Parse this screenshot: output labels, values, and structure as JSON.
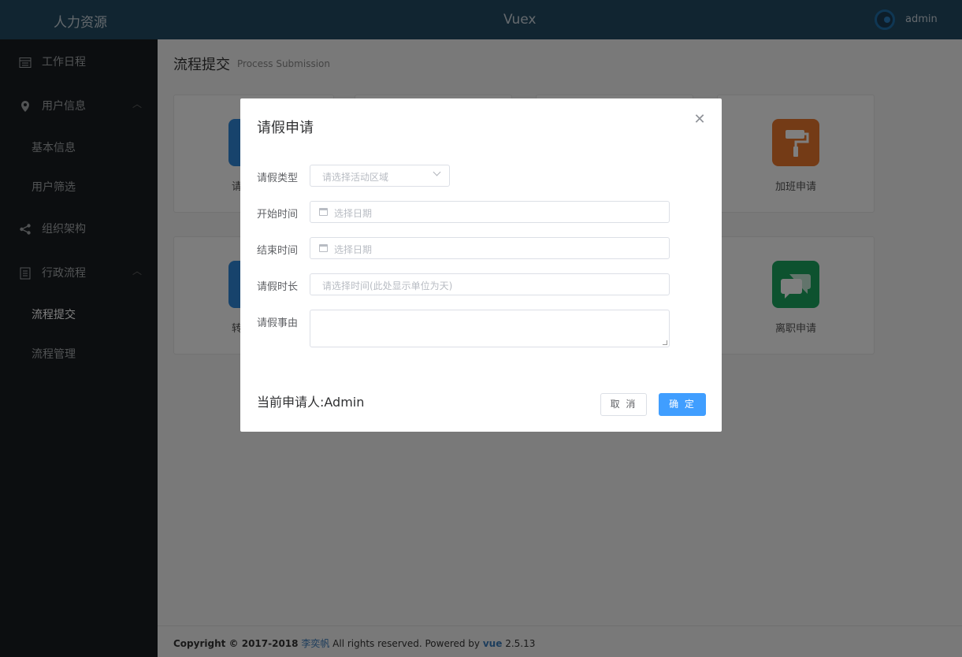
{
  "header": {
    "brand": "人力资源",
    "center_title": "Vuex",
    "user": "admin"
  },
  "sidebar": {
    "items": [
      {
        "label": "工作日程",
        "icon": "calendar-icon"
      },
      {
        "label": "用户信息",
        "icon": "location-pin-icon",
        "expanded": true,
        "children": [
          "基本信息",
          "用户筛选"
        ]
      },
      {
        "label": "组织架构",
        "icon": "share-icon"
      },
      {
        "label": "行政流程",
        "icon": "document-icon",
        "expanded": true,
        "children": [
          "流程提交",
          "流程管理"
        ],
        "active_child": "流程提交"
      }
    ]
  },
  "page": {
    "title": "流程提交",
    "subtitle": "Process Submission"
  },
  "tiles": {
    "visible": [
      {
        "label": "加班申请",
        "icon": "paint-roller-icon",
        "color": "#e8762d"
      },
      {
        "label": "离职申请",
        "icon": "chat-bubbles-icon",
        "color": "#1aa55e"
      }
    ],
    "partial_labels": [
      "请",
      "转"
    ]
  },
  "footer": {
    "prefix": "Copyright © 2017-2018",
    "author": "李奕帆",
    "middle": "All rights reserved. Powered by",
    "framework": "vue",
    "version": "2.5.13"
  },
  "dialog": {
    "title": "请假申请",
    "fields": {
      "leave_type": {
        "label": "请假类型",
        "placeholder": "请选择活动区域"
      },
      "start_time": {
        "label": "开始时间",
        "placeholder": "选择日期"
      },
      "end_time": {
        "label": "结束时间",
        "placeholder": "选择日期"
      },
      "duration": {
        "label": "请假时长",
        "placeholder": "请选择时间(此处显示单位为天)"
      },
      "reason": {
        "label": "请假事由",
        "value": ""
      }
    },
    "applicant": "当前申请人:Admin",
    "cancel_label": "取 消",
    "confirm_label": "确 定"
  },
  "colors": {
    "header_bg": "#234a63",
    "sidebar_bg": "#191c20",
    "primary": "#409eff"
  }
}
